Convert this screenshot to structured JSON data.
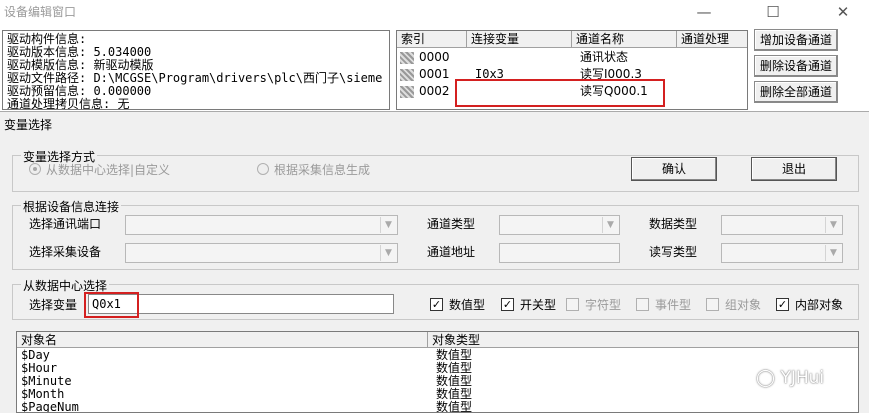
{
  "bg_window": {
    "title": "设备编辑窗口",
    "info_lines": [
      "驱动构件信息:",
      "驱动版本信息: 5.034000",
      "驱动模版信息: 新驱动模版",
      "驱动文件路径: D:\\MCGSE\\Program\\drivers\\plc\\西门子\\sieme",
      "驱动预留信息: 0.000000",
      "通道处理拷贝信息: 无"
    ],
    "channel_table": {
      "headers": [
        "索引",
        "连接变量",
        "通道名称",
        "通道处理"
      ],
      "rows": [
        {
          "index": "0000",
          "var": "",
          "name": "通讯状态",
          "proc": ""
        },
        {
          "index": "0001",
          "var": "I0x3",
          "name": "读写I000.3",
          "proc": ""
        },
        {
          "index": "0002",
          "var": "",
          "name": "读写Q000.1",
          "proc": ""
        }
      ]
    },
    "side_buttons": [
      "增加设备通道",
      "删除设备通道",
      "删除全部通道"
    ]
  },
  "dialog": {
    "title": "变量选择",
    "mode_group": {
      "title": "变量选择方式",
      "option1": "从数据中心选择|自定义",
      "option2": "根据采集信息生成",
      "selected": "option1"
    },
    "ok_label": "确认",
    "exit_label": "退出",
    "device_group": {
      "title": "根据设备信息连接",
      "port_label": "选择通讯端口",
      "device_label": "选择采集设备",
      "chtype_label": "通道类型",
      "chaddr_label": "通道地址",
      "datatype_label": "数据类型",
      "rwtype_label": "读写类型"
    },
    "center_group": {
      "title": "从数据中心选择",
      "select_label": "选择变量",
      "select_value": "Q0x1",
      "filters": [
        {
          "label": "数值型",
          "checked": true,
          "enabled": true
        },
        {
          "label": "开关型",
          "checked": true,
          "enabled": true
        },
        {
          "label": "字符型",
          "checked": false,
          "enabled": false
        },
        {
          "label": "事件型",
          "checked": false,
          "enabled": false
        },
        {
          "label": "组对象",
          "checked": false,
          "enabled": false
        },
        {
          "label": "内部对象",
          "checked": true,
          "enabled": true
        }
      ]
    },
    "object_table": {
      "headers": [
        "对象名",
        "对象类型"
      ],
      "rows": [
        {
          "name": "$Day",
          "type": "数值型"
        },
        {
          "name": "$Hour",
          "type": "数值型"
        },
        {
          "name": "$Minute",
          "type": "数值型"
        },
        {
          "name": "$Month",
          "type": "数值型"
        },
        {
          "name": "$PageNum",
          "type": "数值型"
        }
      ]
    }
  },
  "watermark": "YJHui",
  "colors": {
    "highlight_box": "#d42020"
  }
}
